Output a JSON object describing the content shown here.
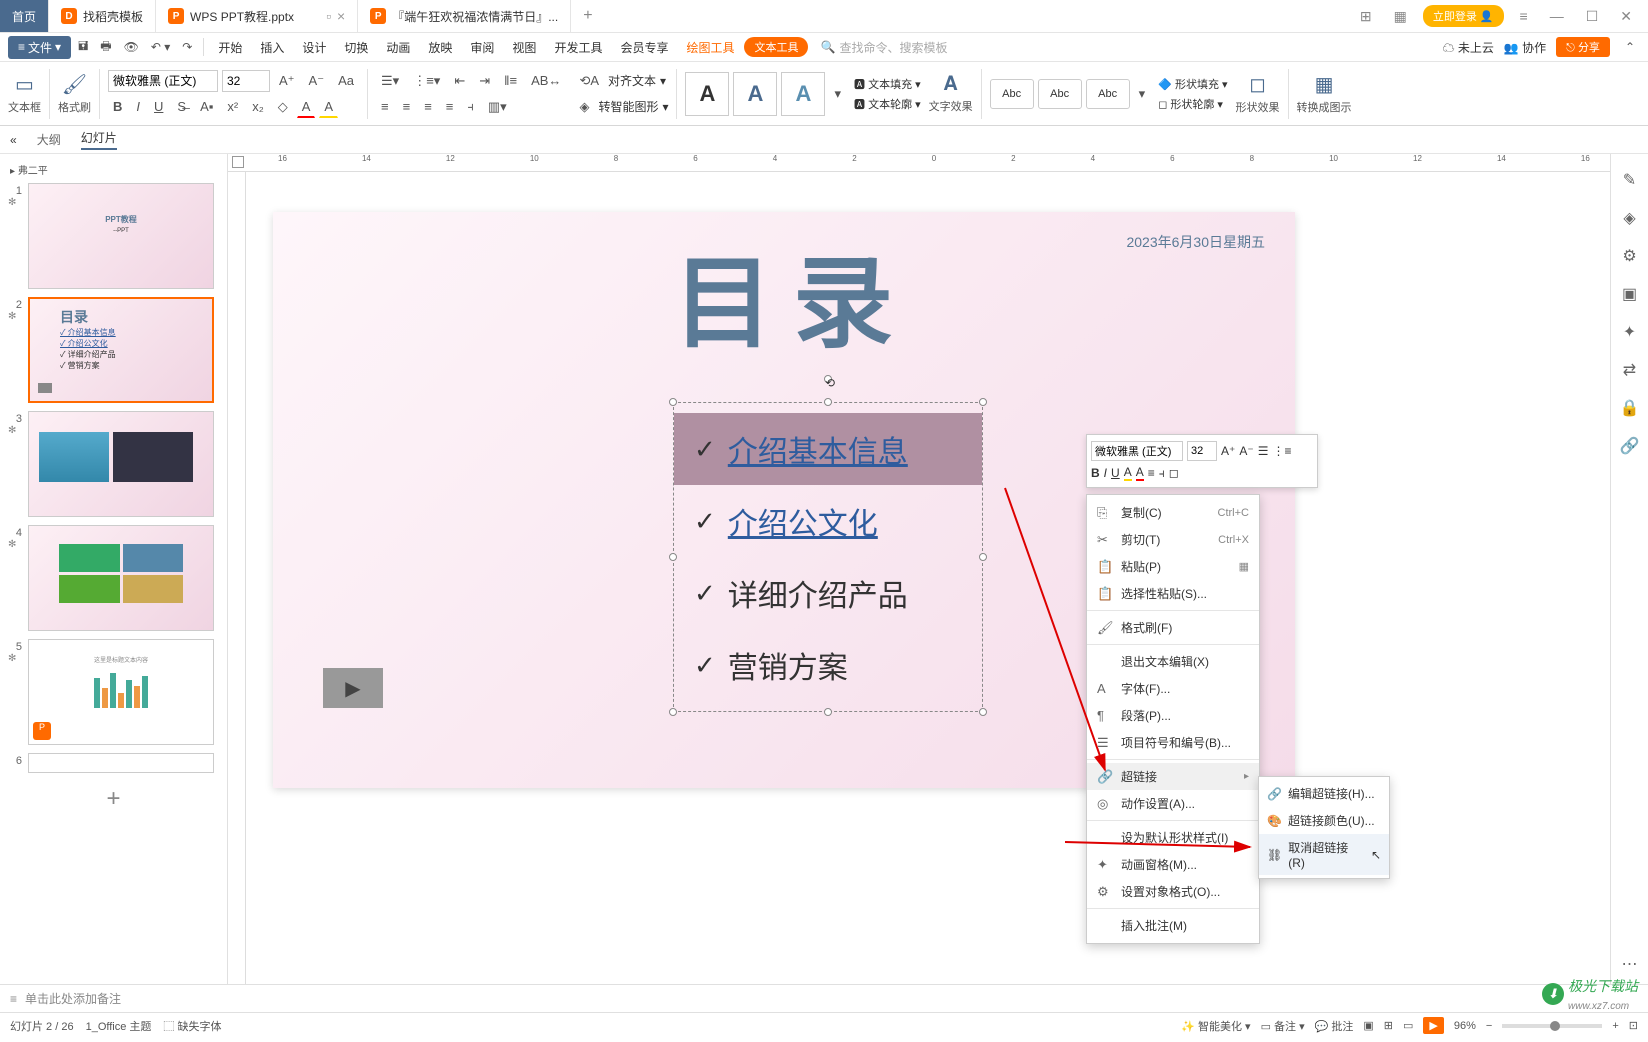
{
  "titlebar": {
    "home": "首页",
    "tab1": "找稻壳模板",
    "tab2": "WPS PPT教程.pptx",
    "tab3": "『端午狂欢祝福浓情满节日』...",
    "login": "立即登录"
  },
  "menubar": {
    "file": "文件",
    "tabs": [
      "开始",
      "插入",
      "设计",
      "切换",
      "动画",
      "放映",
      "审阅",
      "视图",
      "开发工具",
      "会员专享"
    ],
    "draw_tool": "绘图工具",
    "text_tool": "文本工具",
    "search_placeholder": "查找命令、搜索模板",
    "cloud": "未上云",
    "collab": "协作",
    "share": "分享"
  },
  "ribbon": {
    "textbox": "文本框",
    "format_brush": "格式刷",
    "font_name": "微软雅黑 (正文)",
    "font_size": "32",
    "align_text": "对齐文本",
    "convert_smart": "转智能图形",
    "text_fill": "文本填充",
    "text_outline": "文本轮廓",
    "text_effect": "文字效果",
    "abc": "Abc",
    "shape_fill": "形状填充",
    "shape_outline": "形状轮廓",
    "shape_effect": "形状效果",
    "convert_diagram": "转换成图示"
  },
  "outline_tabs": {
    "outline": "大纲",
    "slides": "幻灯片"
  },
  "thumbs_header": "弗二平",
  "slide": {
    "date": "2023年6月30日星期五",
    "title": "目录",
    "items": [
      "介绍基本信息",
      "介绍公文化",
      "详细介绍产品",
      "营销方案"
    ],
    "page_num": "2"
  },
  "float_toolbar": {
    "font": "微软雅黑 (正文)",
    "size": "32"
  },
  "context_menu": {
    "copy": "复制(C)",
    "copy_sc": "Ctrl+C",
    "cut": "剪切(T)",
    "cut_sc": "Ctrl+X",
    "paste": "粘贴(P)",
    "paste_special": "选择性粘贴(S)...",
    "format_brush": "格式刷(F)",
    "exit_edit": "退出文本编辑(X)",
    "font": "字体(F)...",
    "paragraph": "段落(P)...",
    "bullets": "项目符号和编号(B)...",
    "hyperlink": "超链接",
    "action": "动作设置(A)...",
    "default_shape": "设为默认形状样式(I)",
    "anim_pane": "动画窗格(M)...",
    "format_obj": "设置对象格式(O)...",
    "insert_comment": "插入批注(M)"
  },
  "submenu": {
    "edit_link": "编辑超链接(H)...",
    "link_color": "超链接颜色(U)...",
    "remove_link": "取消超链接(R)"
  },
  "notes": "单击此处添加备注",
  "status": {
    "slide_count": "幻灯片 2 / 26",
    "theme": "1_Office 主题",
    "missing_font": "缺失字体",
    "beautify": "智能美化",
    "notes": "备注",
    "comments": "批注",
    "zoom": "96%"
  },
  "watermark": {
    "text": "极光下载站",
    "url": "www.xz7.com"
  }
}
